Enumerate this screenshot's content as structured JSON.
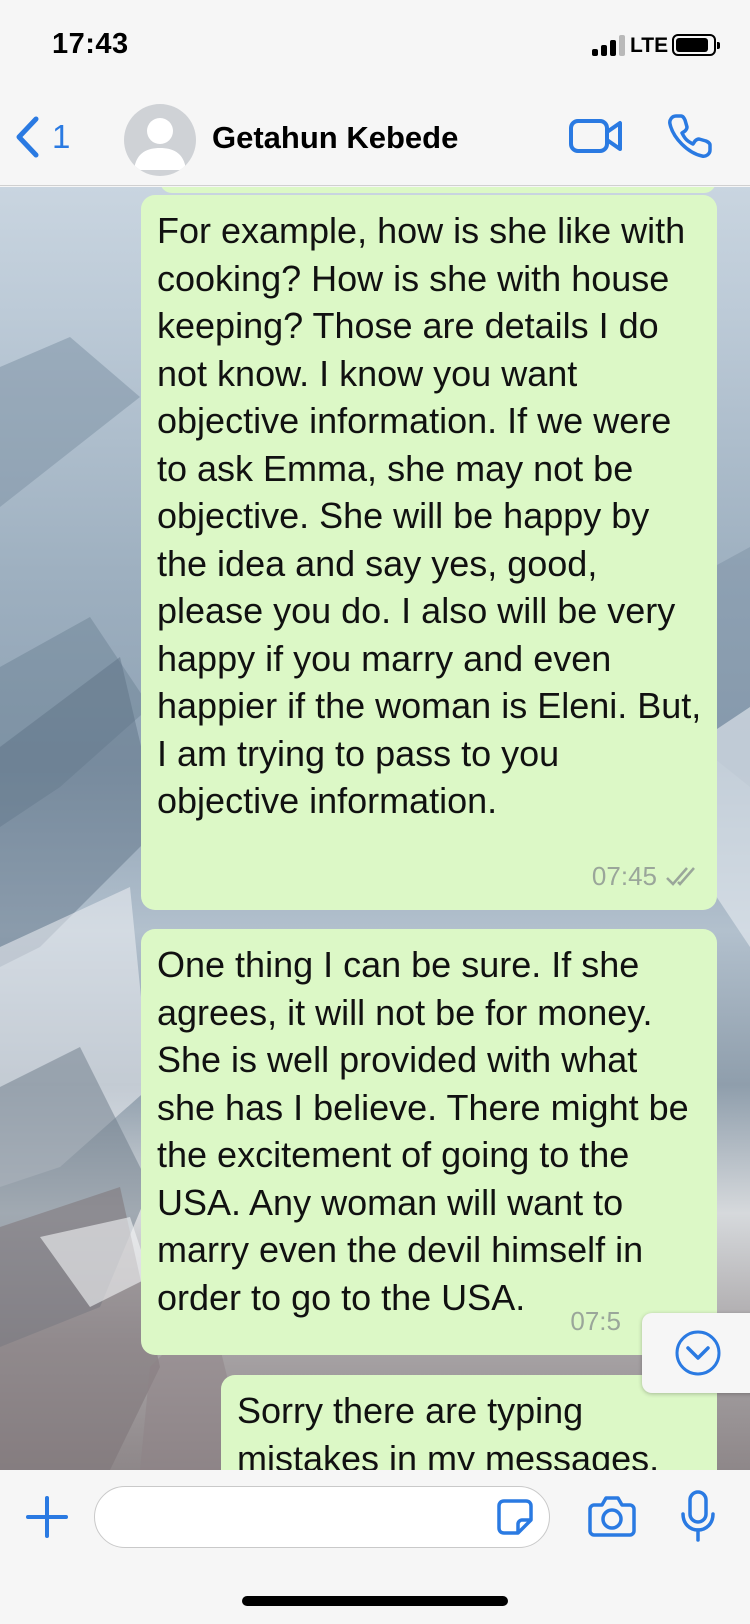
{
  "status_bar": {
    "time": "17:43",
    "network": "LTE",
    "icons": [
      "signal-icon",
      "battery-icon"
    ]
  },
  "header": {
    "back_count": "1",
    "contact_name": "Getahun Kebede",
    "icons": [
      "back-chevron-icon",
      "avatar-icon",
      "video-call-icon",
      "phone-icon"
    ],
    "accent_color": "#2a7ae2"
  },
  "chat": {
    "bubble_color": "#dcf8c6",
    "messages": [
      {
        "text": "For example, how is she like with cooking? How is she with house keeping? Those are details I do not know. I know you want objective information. If we were to ask Emma, she may not be objective. She will be happy by the idea and say yes, good, please you do. I also will be very happy if you marry and even happier if the woman is Eleni. But, I am trying to pass to you objective information.",
        "time": "07:45",
        "status": "read"
      },
      {
        "text": "One thing I can be sure. If she agrees, it will not be for money. She is well provided with what she has I believe. There might be the excitement of going to the USA. Any woman will want to marry even the devil himself in order to go to the USA.",
        "time": "07:5"
      },
      {
        "text": "Sorry there are typing mistakes in my messages."
      }
    ]
  },
  "scroll_button": {
    "icon": "chevron-down-circle-icon"
  },
  "input_bar": {
    "placeholder": "",
    "icons": [
      "plus-icon",
      "sticker-icon",
      "camera-icon",
      "microphone-icon"
    ]
  }
}
